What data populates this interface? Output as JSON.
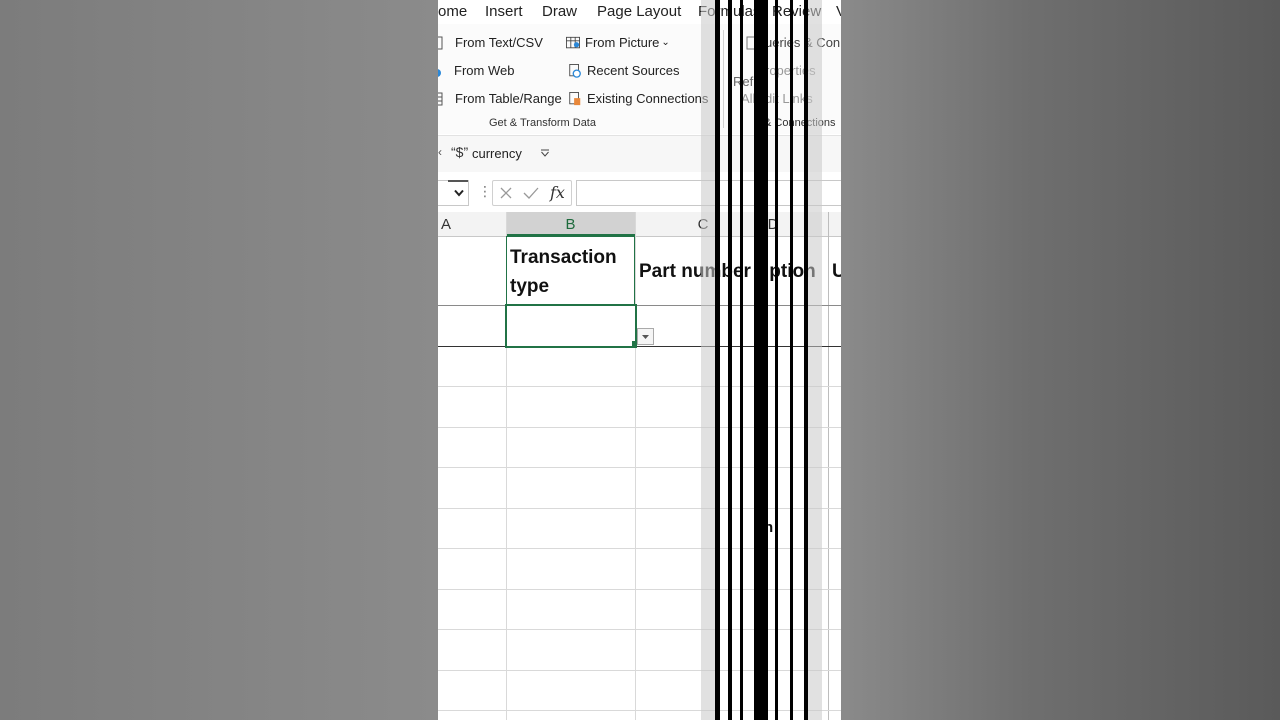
{
  "menu": {
    "tabs": [
      "ome",
      "Insert",
      "Draw",
      "Page Layout",
      "Formulas",
      "Review",
      "V"
    ]
  },
  "ribbon": {
    "get_transform": {
      "from_text_csv": "From Text/CSV",
      "from_web": "From Web",
      "from_table_range": "From Table/Range",
      "from_picture": "From Picture",
      "recent_sources": "Recent Sources",
      "existing_connections": "Existing Connections",
      "group_label": "Get & Transform Data"
    },
    "queries": {
      "queries_connections": "ueries & Conne",
      "properties": "roperties",
      "edit_links": "dit Links",
      "refresh_all": "Refr",
      "all_label": "All",
      "group_label": "& Connections"
    }
  },
  "qat": {
    "currency_label": "currency",
    "currency_glyph": "“$”"
  },
  "formula_bar": {
    "fx_label": "fx",
    "value": ""
  },
  "grid": {
    "columns": [
      "A",
      "B",
      "C",
      "D",
      ""
    ],
    "header_row": {
      "B": [
        "Transaction",
        "type"
      ],
      "C": "Part number",
      "D": "iption",
      "E": "U"
    },
    "stray_text": "n"
  },
  "colors": {
    "selection_green": "#217346",
    "header_bg": "#f3f3f3",
    "gridline": "#d9d9d9"
  }
}
